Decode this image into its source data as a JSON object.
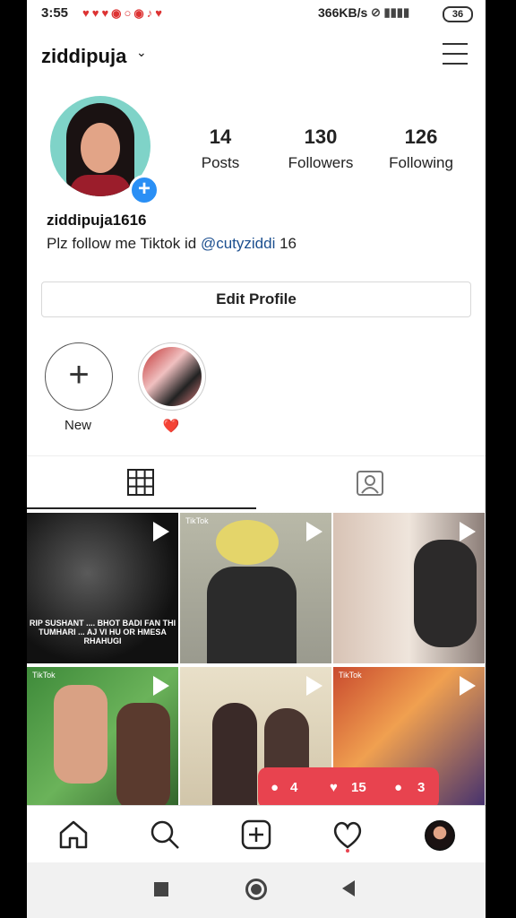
{
  "status_bar": {
    "time": "3:55",
    "network_speed": "366KB/s",
    "battery": "36"
  },
  "profile": {
    "username": "ziddipuja",
    "handle": "ziddipuja1616",
    "bio_prefix": "Plz follow me Tiktok id ",
    "bio_mention": "@cutyziddi",
    "bio_suffix": " 16",
    "stats": [
      {
        "value": "14",
        "label": "Posts"
      },
      {
        "value": "130",
        "label": "Followers"
      },
      {
        "value": "126",
        "label": "Following"
      }
    ],
    "edit_label": "Edit Profile"
  },
  "highlights": [
    {
      "label": "New"
    },
    {
      "label": "❤️"
    }
  ],
  "grid": {
    "posts": [
      {
        "caption": "RIP SUSHANT .... BHOT BADI FAN THI TUMHARI ... AJ VI HU OR HMESA RHAHUGI",
        "tiktok": ""
      },
      {
        "caption": "",
        "tiktok": "TikTok"
      },
      {
        "caption": "",
        "tiktok": ""
      },
      {
        "caption": "",
        "tiktok": "TikTok"
      },
      {
        "caption": "",
        "tiktok": ""
      },
      {
        "caption": "",
        "tiktok": "TikTok"
      }
    ]
  },
  "notifications": {
    "comments": "4",
    "likes": "15",
    "follows": "3"
  },
  "colors": {
    "accent_blue": "#2a8ff5",
    "notif_red": "#e8434f",
    "mention_blue": "#1c4f8f"
  },
  "icons": {
    "nav": [
      "home-icon",
      "search-icon",
      "add-post-icon",
      "activity-heart-icon",
      "profile-avatar"
    ],
    "system": [
      "recents-icon",
      "home-circle-icon",
      "back-icon"
    ]
  }
}
